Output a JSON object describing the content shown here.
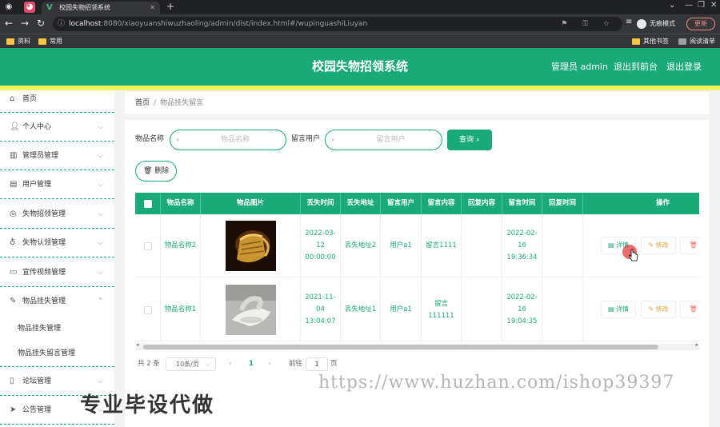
{
  "browser": {
    "tab_title": "校园失物招领系统",
    "url_host": "localhost",
    "url_path": ":8080/xiaoyuanshiwuzhaoling/admin/dist/index.html#/wupinguashiLiuyan",
    "incognito_label": "无痕模式",
    "update_label": "更新",
    "bookmarks": [
      "资料",
      "常用"
    ],
    "bookmarks_right": [
      "其他书签",
      "阅读清单"
    ]
  },
  "header": {
    "title": "校园失物招领系统",
    "admin_label": "管理员 admin",
    "to_front": "退出到前台",
    "logout": "退出登录"
  },
  "sidebar": {
    "items": [
      {
        "label": "首页",
        "icon": "home-icon"
      },
      {
        "label": "个人中心",
        "icon": "user-icon"
      },
      {
        "label": "管理员管理",
        "icon": "chart-icon"
      },
      {
        "label": "用户管理",
        "icon": "list-icon"
      },
      {
        "label": "失物招领管理",
        "icon": "target-icon"
      },
      {
        "label": "失物认领管理",
        "icon": "mic-icon"
      },
      {
        "label": "宣传视频管理",
        "icon": "folder-icon"
      },
      {
        "label": "物品挂失管理",
        "icon": "edit-icon"
      },
      {
        "label": "论坛管理",
        "icon": "phone-icon"
      },
      {
        "label": "公告管理",
        "icon": "send-icon"
      }
    ],
    "subitems": [
      "物品挂失管理",
      "物品挂失留言管理"
    ]
  },
  "breadcrumb": {
    "home": "首页",
    "sep": "/",
    "current": "物品挂失留言"
  },
  "search": {
    "name_label": "物品名称",
    "name_placeholder": "物品名称",
    "user_label": "留言用户",
    "user_placeholder": "留言用户",
    "query_label": "查询",
    "delete_label": "删除"
  },
  "table": {
    "columns": [
      "物品名称",
      "物品图片",
      "丢失时间",
      "丢失地址",
      "留言用户",
      "留言内容",
      "回复内容",
      "留言时间",
      "回复时间",
      "操作"
    ],
    "rows": [
      {
        "name": "物品名称2",
        "lost_time": "2022-03-12 00:00:00",
        "lost_addr": "丢失地址2",
        "user": "用户a1",
        "content": "留言1111",
        "reply": "",
        "msg_time": "2022-02-16 19:36:34",
        "reply_time": ""
      },
      {
        "name": "物品名称1",
        "lost_time": "2021-11-04 13:04:07",
        "lost_addr": "丢失地址1",
        "user": "用户a1",
        "content": "留言111111",
        "reply": "",
        "msg_time": "2022-02-16 19:04:35",
        "reply_time": ""
      }
    ],
    "ops": {
      "detail": "详情",
      "edit": "修改",
      "delete": "删"
    }
  },
  "pagination": {
    "total": "共 2 条",
    "page_size": "10条/页",
    "prev": "‹",
    "current": "1",
    "next": "›",
    "goto_label": "前往",
    "goto_value": "1",
    "page_suffix": "页"
  },
  "watermark": {
    "left": "专业毕设代做",
    "right": "https://www.huzhan.com/ishop39397"
  },
  "colors": {
    "primary": "#1aaa78",
    "accent_bar": "#f3f35a",
    "warning": "#e6a23c",
    "danger": "#f56c6c"
  }
}
